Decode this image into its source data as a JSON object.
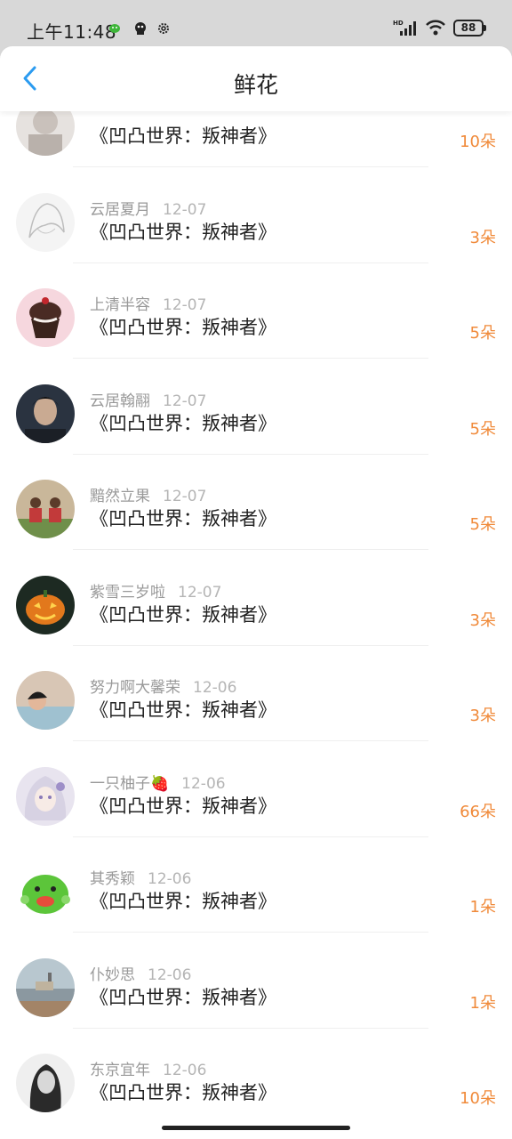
{
  "status_bar": {
    "time": "上午11:48",
    "battery": "88",
    "net_label": "HD"
  },
  "header": {
    "title": "鲜花",
    "back_icon": "chevron-left-icon"
  },
  "colors": {
    "accent": "#f08a3a",
    "back": "#2b9bf0"
  },
  "items": [
    {
      "name": "",
      "date": "",
      "book": "《凹凸世界：叛神者》",
      "count": "10朵",
      "avatar": "sketch-figure"
    },
    {
      "name": "云居夏月",
      "date": "12-07",
      "book": "《凹凸世界：叛神者》",
      "count": "3朵",
      "avatar": "sketch-anime"
    },
    {
      "name": "上清半容",
      "date": "12-07",
      "book": "《凹凸世界：叛神者》",
      "count": "5朵",
      "avatar": "cupcake"
    },
    {
      "name": "云居翰翮",
      "date": "12-07",
      "book": "《凹凸世界：叛神者》",
      "count": "5朵",
      "avatar": "dark-portrait"
    },
    {
      "name": "黯然立果",
      "date": "12-07",
      "book": "《凹凸世界：叛神者》",
      "count": "5朵",
      "avatar": "two-people"
    },
    {
      "name": "紫雪三岁啦",
      "date": "12-07",
      "book": "《凹凸世界：叛神者》",
      "count": "3朵",
      "avatar": "pumpkin"
    },
    {
      "name": "努力啊大馨荣",
      "date": "12-06",
      "book": "《凹凸世界：叛神者》",
      "count": "3朵",
      "avatar": "child-bath"
    },
    {
      "name": "一只柚子",
      "date": "12-06",
      "book": "《凹凸世界：叛神者》",
      "count": "66朵",
      "avatar": "anime-girl",
      "emoji": "🍓"
    },
    {
      "name": "其秀颖",
      "date": "12-06",
      "book": "《凹凸世界：叛神者》",
      "count": "1朵",
      "avatar": "green-creature"
    },
    {
      "name": "仆妙思",
      "date": "12-06",
      "book": "《凹凸世界：叛神者》",
      "count": "1朵",
      "avatar": "seaside"
    },
    {
      "name": "东京宜年",
      "date": "12-06",
      "book": "《凹凸世界：叛神者》",
      "count": "10朵",
      "avatar": "bw-portrait"
    }
  ]
}
